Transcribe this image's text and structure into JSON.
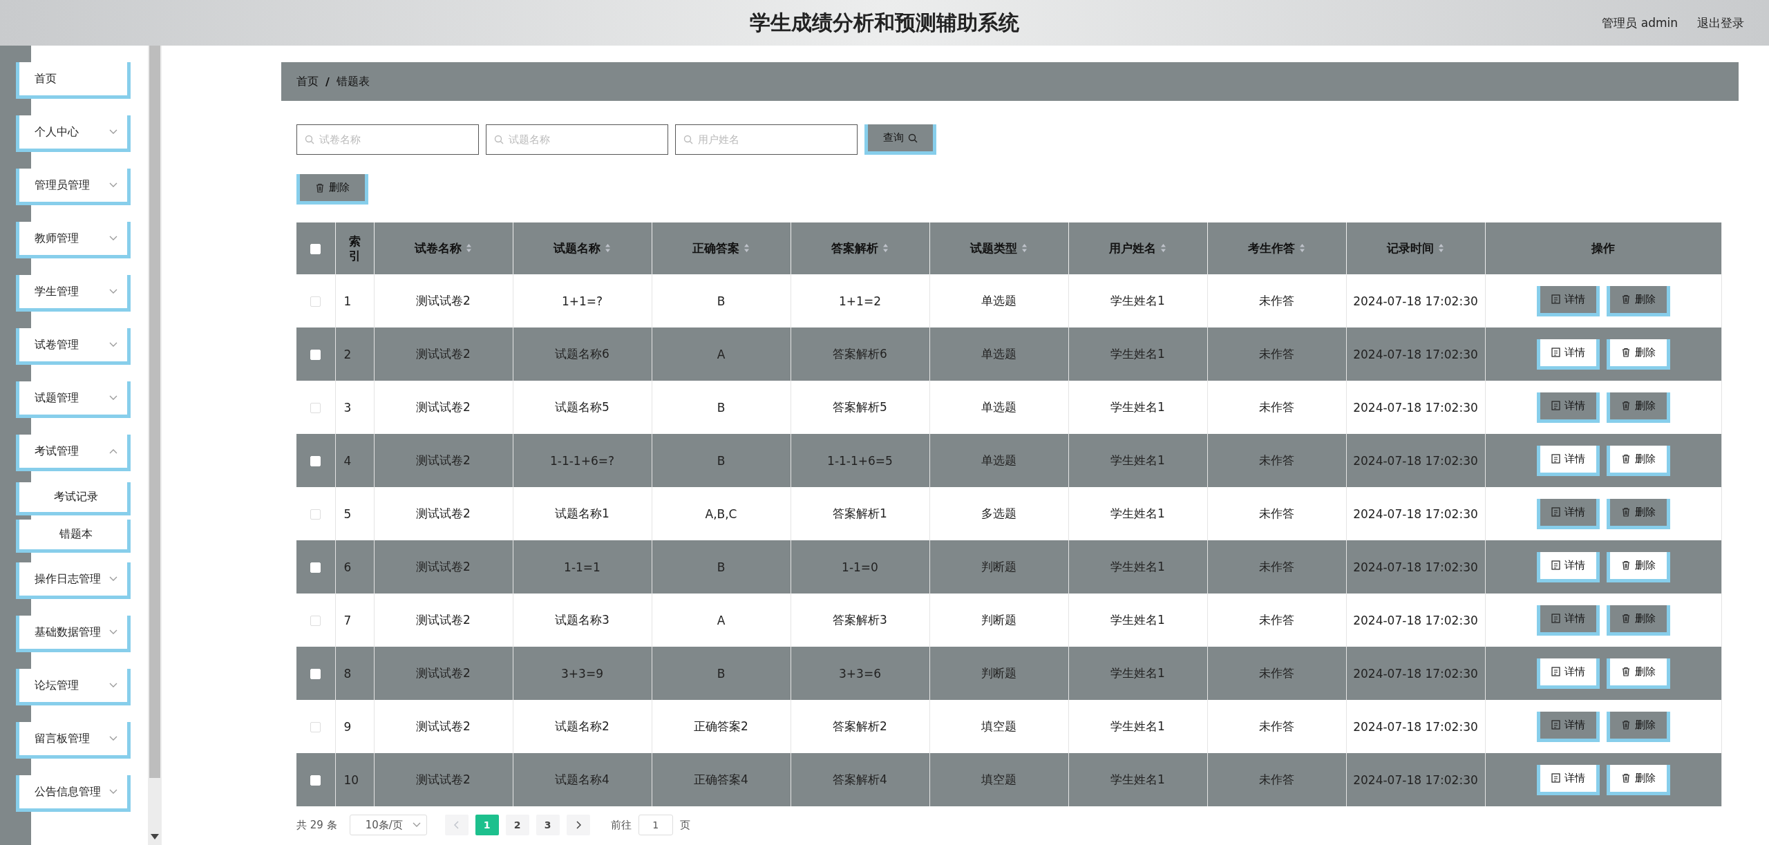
{
  "header": {
    "title": "学生成绩分析和预测辅助系统",
    "user": "管理员 admin",
    "logout": "退出登录"
  },
  "sidebar": {
    "items": [
      {
        "label": "首页"
      },
      {
        "label": "个人中心",
        "expanded": false
      },
      {
        "label": "管理员管理",
        "expanded": false
      },
      {
        "label": "教师管理",
        "expanded": false
      },
      {
        "label": "学生管理",
        "expanded": false
      },
      {
        "label": "试卷管理",
        "expanded": false
      },
      {
        "label": "试题管理",
        "expanded": false
      },
      {
        "label": "考试管理",
        "expanded": true,
        "children": [
          {
            "label": "考试记录"
          },
          {
            "label": "错题本"
          }
        ]
      },
      {
        "label": "操作日志管理",
        "expanded": false
      },
      {
        "label": "基础数据管理",
        "expanded": false
      },
      {
        "label": "论坛管理",
        "expanded": false
      },
      {
        "label": "留言板管理",
        "expanded": false
      },
      {
        "label": "公告信息管理",
        "expanded": false
      }
    ]
  },
  "breadcrumb": {
    "items": [
      "首页",
      "错题表"
    ],
    "separator": "/"
  },
  "search": {
    "fields": [
      {
        "placeholder": "试卷名称"
      },
      {
        "placeholder": "试题名称"
      },
      {
        "placeholder": "用户姓名"
      }
    ],
    "button": "查询"
  },
  "delete_button": "删除",
  "table": {
    "all_checked": false,
    "columns": [
      {
        "label": "索引",
        "sortable": false
      },
      {
        "label": "试卷名称",
        "sortable": true
      },
      {
        "label": "试题名称",
        "sortable": true
      },
      {
        "label": "正确答案",
        "sortable": true
      },
      {
        "label": "答案解析",
        "sortable": true
      },
      {
        "label": "试题类型",
        "sortable": true
      },
      {
        "label": "用户姓名",
        "sortable": true
      },
      {
        "label": "考生作答",
        "sortable": true
      },
      {
        "label": "记录时间",
        "sortable": true
      },
      {
        "label": "操作",
        "sortable": false
      }
    ],
    "rows": [
      {
        "checked": false,
        "cells": [
          "1",
          "测试试卷2",
          "1+1=?",
          "B",
          "1+1=2",
          "单选题",
          "学生姓名1",
          "未作答",
          "2024-07-18 17:02:30"
        ],
        "actions": [
          "详情",
          "删除"
        ]
      },
      {
        "checked": false,
        "cells": [
          "2",
          "测试试卷2",
          "试题名称6",
          "A",
          "答案解析6",
          "单选题",
          "学生姓名1",
          "未作答",
          "2024-07-18 17:02:30"
        ],
        "actions": [
          "详情",
          "删除"
        ]
      },
      {
        "checked": false,
        "cells": [
          "3",
          "测试试卷2",
          "试题名称5",
          "B",
          "答案解析5",
          "单选题",
          "学生姓名1",
          "未作答",
          "2024-07-18 17:02:30"
        ],
        "actions": [
          "详情",
          "删除"
        ]
      },
      {
        "checked": false,
        "cells": [
          "4",
          "测试试卷2",
          "1-1-1+6=?",
          "B",
          "1-1-1+6=5",
          "单选题",
          "学生姓名1",
          "未作答",
          "2024-07-18 17:02:30"
        ],
        "actions": [
          "详情",
          "删除"
        ]
      },
      {
        "checked": false,
        "cells": [
          "5",
          "测试试卷2",
          "试题名称1",
          "A,B,C",
          "答案解析1",
          "多选题",
          "学生姓名1",
          "未作答",
          "2024-07-18 17:02:30"
        ],
        "actions": [
          "详情",
          "删除"
        ]
      },
      {
        "checked": false,
        "cells": [
          "6",
          "测试试卷2",
          "1-1=1",
          "B",
          "1-1=0",
          "判断题",
          "学生姓名1",
          "未作答",
          "2024-07-18 17:02:30"
        ],
        "actions": [
          "详情",
          "删除"
        ]
      },
      {
        "checked": false,
        "cells": [
          "7",
          "测试试卷2",
          "试题名称3",
          "A",
          "答案解析3",
          "判断题",
          "学生姓名1",
          "未作答",
          "2024-07-18 17:02:30"
        ],
        "actions": [
          "详情",
          "删除"
        ]
      },
      {
        "checked": false,
        "cells": [
          "8",
          "测试试卷2",
          "3+3=9",
          "B",
          "3+3=6",
          "判断题",
          "学生姓名1",
          "未作答",
          "2024-07-18 17:02:30"
        ],
        "actions": [
          "详情",
          "删除"
        ]
      },
      {
        "checked": false,
        "cells": [
          "9",
          "测试试卷2",
          "试题名称2",
          "正确答案2",
          "答案解析2",
          "填空题",
          "学生姓名1",
          "未作答",
          "2024-07-18 17:02:30"
        ],
        "actions": [
          "详情",
          "删除"
        ]
      },
      {
        "checked": false,
        "cells": [
          "10",
          "测试试卷2",
          "试题名称4",
          "正确答案4",
          "答案解析4",
          "填空题",
          "学生姓名1",
          "未作答",
          "2024-07-18 17:02:30"
        ],
        "actions": [
          "详情",
          "删除"
        ]
      }
    ]
  },
  "pagination": {
    "total": "共 29 条",
    "page_size": "10条/页",
    "pages": [
      {
        "label": "1",
        "selected": true
      },
      {
        "label": "2",
        "selected": false
      },
      {
        "label": "3",
        "selected": false
      }
    ],
    "goto_label": "前往",
    "goto_value": "1",
    "page_unit": "页"
  }
}
